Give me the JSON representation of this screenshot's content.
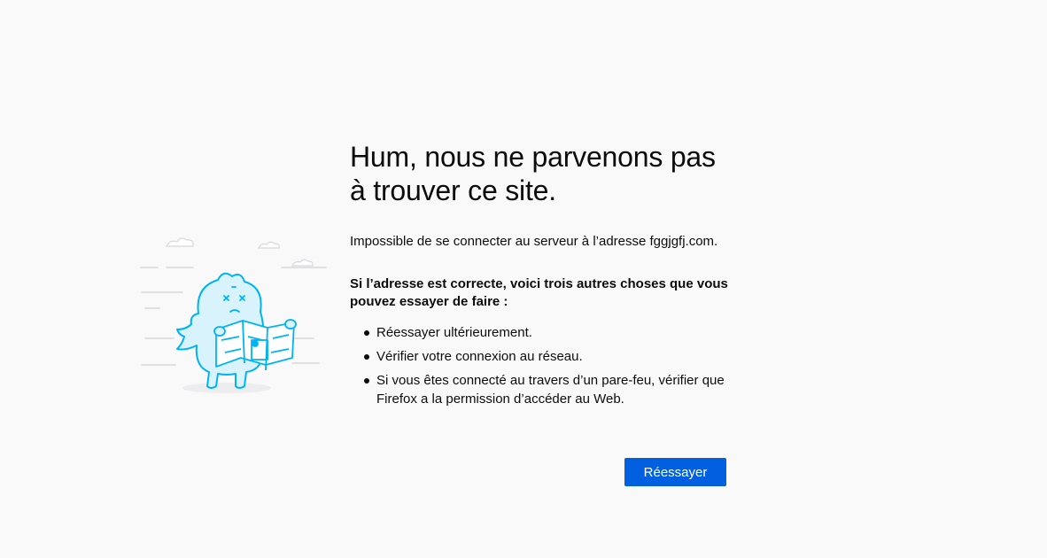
{
  "error_page": {
    "title_line1": "Hum, nous ne parvenons pas",
    "title_line2": "à trouver ce site.",
    "message": "Impossible de se connecter au serveur à l’adresse fggjgfj.com.",
    "suggestions_title_line1": "Si l’adresse est correcte, voici trois autres choses que vous",
    "suggestions_title_line2": "pouvez essayer de faire :",
    "suggestions": [
      {
        "line1": "Réessayer ultérieurement.",
        "line2": ""
      },
      {
        "line1": "Vérifier votre connexion au réseau.",
        "line2": ""
      },
      {
        "line1": "Si vous êtes connecté au travers d’un pare-feu, vérifier que",
        "line2": "Firefox a la permission d’accéder au Web."
      }
    ],
    "retry_label": "Réessayer",
    "illustration_icon": "lost-monster-with-map-illustration",
    "accent_color": "#0060df",
    "illustration_color": "#00b3f4",
    "background_color": "#f9f9fa"
  }
}
